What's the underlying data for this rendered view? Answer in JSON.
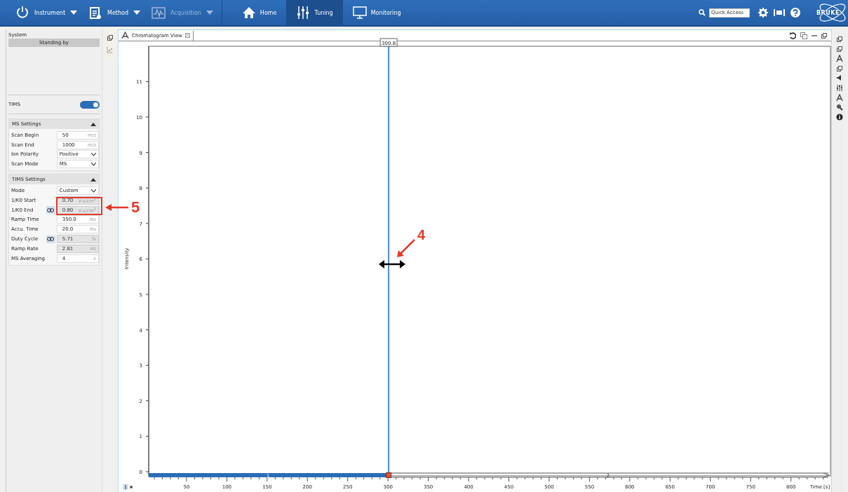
{
  "toolbar": {
    "menus": [
      {
        "label": "Instrument",
        "disabled": false
      },
      {
        "label": "Method",
        "disabled": false
      },
      {
        "label": "Acquisition",
        "disabled": true
      }
    ],
    "tabs": [
      {
        "label": "Home",
        "selected": false
      },
      {
        "label": "Tuning",
        "selected": true
      },
      {
        "label": "Monitoring",
        "selected": false
      }
    ],
    "quick_access": {
      "placeholder": "Quick Access"
    },
    "logo": "BRUKE"
  },
  "sidebar": {
    "system_label": "System",
    "status": "Standing by",
    "tims": {
      "label": "TIMS",
      "on": true
    },
    "sections": [
      {
        "title": "MS Settings",
        "expanded": true,
        "rows": [
          {
            "label": "Scan Begin",
            "kind": "field",
            "value": "50",
            "unit": "m/z",
            "disabled": false,
            "linked": false
          },
          {
            "label": "Scan End",
            "kind": "field",
            "value": "1000",
            "unit": "m/z",
            "disabled": false,
            "linked": false
          },
          {
            "label": "Ion Polarity",
            "kind": "select",
            "value": "Positive",
            "linked": false
          },
          {
            "label": "Scan Mode",
            "kind": "select",
            "value": "MS",
            "linked": false
          }
        ]
      },
      {
        "title": "TIMS Settings",
        "expanded": true,
        "rows": [
          {
            "label": "Mode",
            "kind": "select",
            "value": "Custom",
            "linked": false
          },
          {
            "label": "1/K0 Start",
            "kind": "field",
            "value": "0.70",
            "unit": "V·s/cm$^{2}$",
            "disabled": true,
            "linked": false
          },
          {
            "label": "1/K0 End",
            "kind": "field",
            "value": "0.80",
            "unit": "V·s/cm$^{2}$",
            "disabled": true,
            "linked": true
          },
          {
            "label": "Ramp Time",
            "kind": "field",
            "value": "350.0",
            "unit": "ms",
            "disabled": false,
            "linked": false
          },
          {
            "label": "Accu. Time",
            "kind": "field",
            "value": "20.0",
            "unit": "ms",
            "disabled": false,
            "linked": false
          },
          {
            "label": "Duty Cycle",
            "kind": "field",
            "value": "5.71",
            "unit": "%",
            "disabled": true,
            "linked": true
          },
          {
            "label": "Ramp Rate",
            "kind": "field",
            "value": "2.81",
            "unit": "Hz",
            "disabled": true,
            "linked": false
          },
          {
            "label": "MS Averaging",
            "kind": "field",
            "value": "4",
            "unit": "x",
            "disabled": false,
            "linked": false
          }
        ]
      }
    ]
  },
  "chart_view": {
    "tab": "Chromatogram View",
    "ylabel": "Intensity",
    "xlabel": "Time [s]",
    "yticks": [
      "11",
      "10",
      "9",
      "8",
      "7",
      "6",
      "5",
      "4",
      "3",
      "2",
      "1",
      "0"
    ],
    "xticks": [
      "50",
      "100",
      "150",
      "200",
      "250",
      "300",
      "350",
      "400",
      "450",
      "500",
      "550",
      "600",
      "650",
      "700",
      "750",
      "800"
    ],
    "cursor": "300.8",
    "segments": [
      "1",
      "2"
    ]
  },
  "annotations": [
    {
      "label": "5"
    },
    {
      "label": "4"
    }
  ]
}
